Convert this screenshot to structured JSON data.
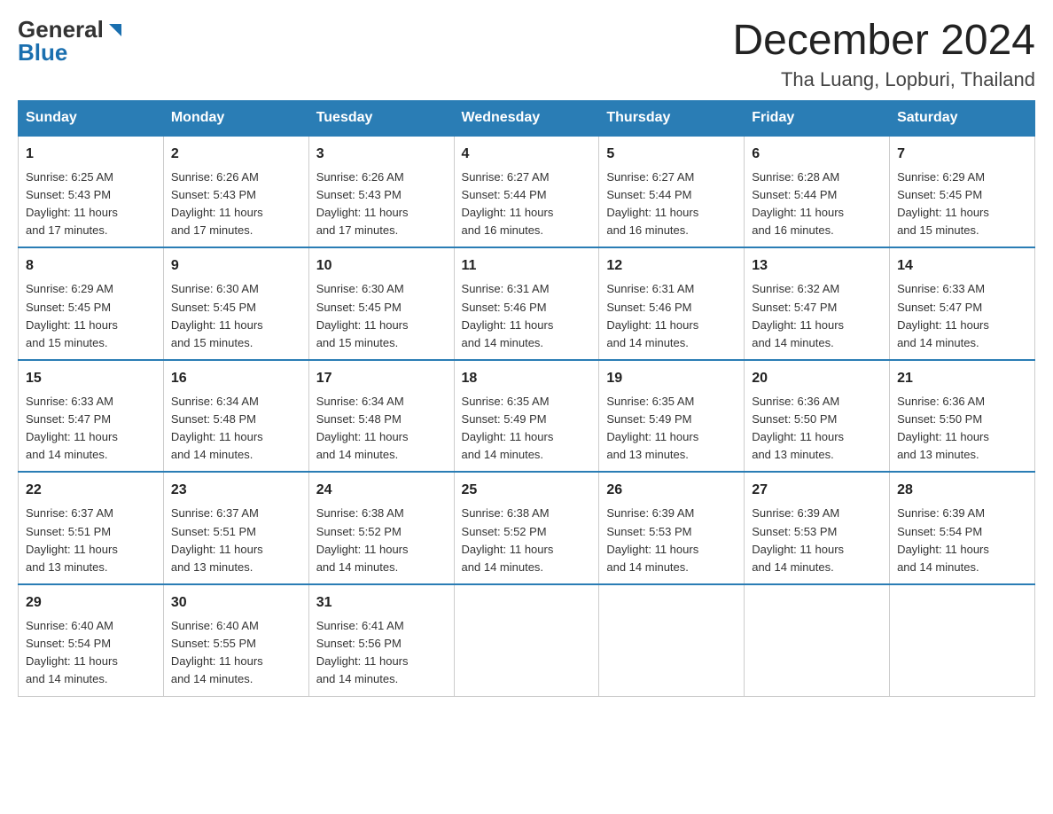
{
  "header": {
    "logo": {
      "general": "General",
      "blue": "Blue"
    },
    "title": "December 2024",
    "location": "Tha Luang, Lopburi, Thailand"
  },
  "days_of_week": [
    "Sunday",
    "Monday",
    "Tuesday",
    "Wednesday",
    "Thursday",
    "Friday",
    "Saturday"
  ],
  "weeks": [
    [
      {
        "day": "1",
        "sunrise": "6:25 AM",
        "sunset": "5:43 PM",
        "daylight": "11 hours and 17 minutes."
      },
      {
        "day": "2",
        "sunrise": "6:26 AM",
        "sunset": "5:43 PM",
        "daylight": "11 hours and 17 minutes."
      },
      {
        "day": "3",
        "sunrise": "6:26 AM",
        "sunset": "5:43 PM",
        "daylight": "11 hours and 17 minutes."
      },
      {
        "day": "4",
        "sunrise": "6:27 AM",
        "sunset": "5:44 PM",
        "daylight": "11 hours and 16 minutes."
      },
      {
        "day": "5",
        "sunrise": "6:27 AM",
        "sunset": "5:44 PM",
        "daylight": "11 hours and 16 minutes."
      },
      {
        "day": "6",
        "sunrise": "6:28 AM",
        "sunset": "5:44 PM",
        "daylight": "11 hours and 16 minutes."
      },
      {
        "day": "7",
        "sunrise": "6:29 AM",
        "sunset": "5:45 PM",
        "daylight": "11 hours and 15 minutes."
      }
    ],
    [
      {
        "day": "8",
        "sunrise": "6:29 AM",
        "sunset": "5:45 PM",
        "daylight": "11 hours and 15 minutes."
      },
      {
        "day": "9",
        "sunrise": "6:30 AM",
        "sunset": "5:45 PM",
        "daylight": "11 hours and 15 minutes."
      },
      {
        "day": "10",
        "sunrise": "6:30 AM",
        "sunset": "5:45 PM",
        "daylight": "11 hours and 15 minutes."
      },
      {
        "day": "11",
        "sunrise": "6:31 AM",
        "sunset": "5:46 PM",
        "daylight": "11 hours and 14 minutes."
      },
      {
        "day": "12",
        "sunrise": "6:31 AM",
        "sunset": "5:46 PM",
        "daylight": "11 hours and 14 minutes."
      },
      {
        "day": "13",
        "sunrise": "6:32 AM",
        "sunset": "5:47 PM",
        "daylight": "11 hours and 14 minutes."
      },
      {
        "day": "14",
        "sunrise": "6:33 AM",
        "sunset": "5:47 PM",
        "daylight": "11 hours and 14 minutes."
      }
    ],
    [
      {
        "day": "15",
        "sunrise": "6:33 AM",
        "sunset": "5:47 PM",
        "daylight": "11 hours and 14 minutes."
      },
      {
        "day": "16",
        "sunrise": "6:34 AM",
        "sunset": "5:48 PM",
        "daylight": "11 hours and 14 minutes."
      },
      {
        "day": "17",
        "sunrise": "6:34 AM",
        "sunset": "5:48 PM",
        "daylight": "11 hours and 14 minutes."
      },
      {
        "day": "18",
        "sunrise": "6:35 AM",
        "sunset": "5:49 PM",
        "daylight": "11 hours and 14 minutes."
      },
      {
        "day": "19",
        "sunrise": "6:35 AM",
        "sunset": "5:49 PM",
        "daylight": "11 hours and 13 minutes."
      },
      {
        "day": "20",
        "sunrise": "6:36 AM",
        "sunset": "5:50 PM",
        "daylight": "11 hours and 13 minutes."
      },
      {
        "day": "21",
        "sunrise": "6:36 AM",
        "sunset": "5:50 PM",
        "daylight": "11 hours and 13 minutes."
      }
    ],
    [
      {
        "day": "22",
        "sunrise": "6:37 AM",
        "sunset": "5:51 PM",
        "daylight": "11 hours and 13 minutes."
      },
      {
        "day": "23",
        "sunrise": "6:37 AM",
        "sunset": "5:51 PM",
        "daylight": "11 hours and 13 minutes."
      },
      {
        "day": "24",
        "sunrise": "6:38 AM",
        "sunset": "5:52 PM",
        "daylight": "11 hours and 14 minutes."
      },
      {
        "day": "25",
        "sunrise": "6:38 AM",
        "sunset": "5:52 PM",
        "daylight": "11 hours and 14 minutes."
      },
      {
        "day": "26",
        "sunrise": "6:39 AM",
        "sunset": "5:53 PM",
        "daylight": "11 hours and 14 minutes."
      },
      {
        "day": "27",
        "sunrise": "6:39 AM",
        "sunset": "5:53 PM",
        "daylight": "11 hours and 14 minutes."
      },
      {
        "day": "28",
        "sunrise": "6:39 AM",
        "sunset": "5:54 PM",
        "daylight": "11 hours and 14 minutes."
      }
    ],
    [
      {
        "day": "29",
        "sunrise": "6:40 AM",
        "sunset": "5:54 PM",
        "daylight": "11 hours and 14 minutes."
      },
      {
        "day": "30",
        "sunrise": "6:40 AM",
        "sunset": "5:55 PM",
        "daylight": "11 hours and 14 minutes."
      },
      {
        "day": "31",
        "sunrise": "6:41 AM",
        "sunset": "5:56 PM",
        "daylight": "11 hours and 14 minutes."
      },
      null,
      null,
      null,
      null
    ]
  ],
  "labels": {
    "sunrise": "Sunrise:",
    "sunset": "Sunset:",
    "daylight": "Daylight:"
  }
}
